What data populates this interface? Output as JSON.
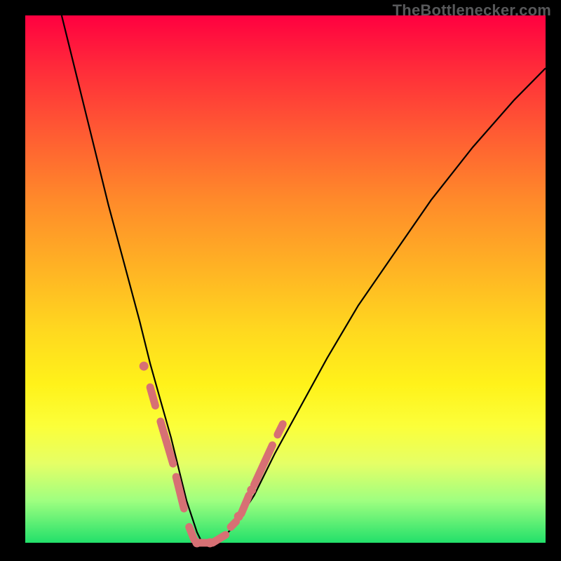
{
  "watermark": "TheBottlenecker.com",
  "colors": {
    "gradient_top": "#ff0040",
    "gradient_bottom": "#22e06a",
    "curve": "#000000",
    "markers": "#d77074",
    "frame": "#000000"
  },
  "chart_data": {
    "type": "line",
    "title": "",
    "xlabel": "",
    "ylabel": "",
    "xlim": [
      0,
      100
    ],
    "ylim": [
      0,
      100
    ],
    "grid": false,
    "legend": false,
    "series": [
      {
        "name": "curve",
        "x": [
          7,
          10,
          13,
          16,
          19,
          22,
          24,
          26,
          28,
          29,
          30,
          31,
          32,
          33,
          34,
          35,
          37,
          40,
          44,
          48,
          53,
          58,
          64,
          71,
          78,
          86,
          94,
          100
        ],
        "y": [
          100,
          88,
          76,
          64,
          53,
          42,
          34,
          27,
          20,
          16,
          12,
          8,
          5,
          2,
          0,
          0,
          0,
          3,
          9,
          17,
          26,
          35,
          45,
          55,
          65,
          75,
          84,
          90
        ]
      }
    ],
    "markers": {
      "dots_x": [
        22.8,
        33,
        35.5,
        41,
        43.5
      ],
      "dots_y": [
        33.5,
        0,
        0,
        5,
        10
      ],
      "thick_segments": [
        {
          "x1": 24.0,
          "y1": 29.5,
          "x2": 25.0,
          "y2": 26.0
        },
        {
          "x1": 26.0,
          "y1": 23.0,
          "x2": 28.4,
          "y2": 15.0
        },
        {
          "x1": 29.0,
          "y1": 12.5,
          "x2": 30.5,
          "y2": 6.5
        },
        {
          "x1": 31.5,
          "y1": 3.0,
          "x2": 32.5,
          "y2": 0.5
        },
        {
          "x1": 33.5,
          "y1": 0.0,
          "x2": 35.0,
          "y2": 0.0
        },
        {
          "x1": 36.0,
          "y1": 0.0,
          "x2": 38.5,
          "y2": 1.5
        },
        {
          "x1": 39.5,
          "y1": 3.0,
          "x2": 40.5,
          "y2": 4.0
        },
        {
          "x1": 41.5,
          "y1": 5.5,
          "x2": 43.0,
          "y2": 9.0
        },
        {
          "x1": 44.0,
          "y1": 11.0,
          "x2": 47.5,
          "y2": 18.5
        },
        {
          "x1": 48.5,
          "y1": 20.5,
          "x2": 49.5,
          "y2": 22.5
        }
      ]
    }
  }
}
